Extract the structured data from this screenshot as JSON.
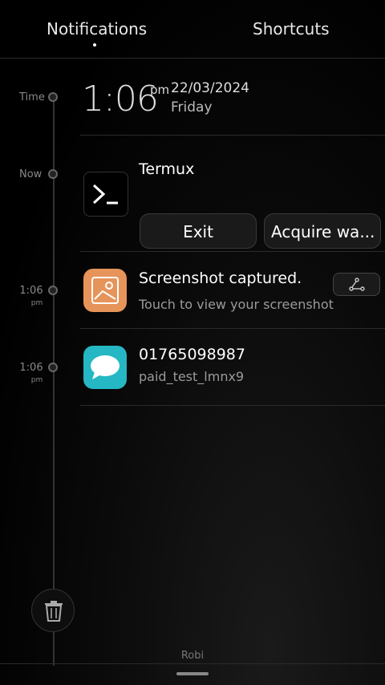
{
  "tabs": {
    "notifications": "Notifications",
    "shortcuts": "Shortcuts"
  },
  "timeline": {
    "time_label": "Time",
    "now_label": "Now",
    "entries": [
      {
        "time": "1:06",
        "ampm": "pm"
      },
      {
        "time": "1:06",
        "ampm": "pm"
      }
    ]
  },
  "clock": {
    "time": "1:06",
    "ampm": "pm",
    "date": "22/03/2024",
    "day": "Friday"
  },
  "notifications": [
    {
      "app": "Termux",
      "actions": [
        "Exit",
        "Acquire wa..."
      ],
      "icon": "terminal-icon"
    },
    {
      "title": "Screenshot captured.",
      "subtitle": "Touch to view your screenshot",
      "icon": "image-icon",
      "action_icon": "share-icon"
    },
    {
      "title": "01765098987",
      "subtitle": "paid_test_lmnx9",
      "icon": "message-bubble-icon"
    }
  ],
  "footer": {
    "carrier": "Robi",
    "clear_icon": "trash-icon"
  },
  "colors": {
    "screenshot_icon": "#e6945a",
    "message_icon": "#25b7c3"
  }
}
